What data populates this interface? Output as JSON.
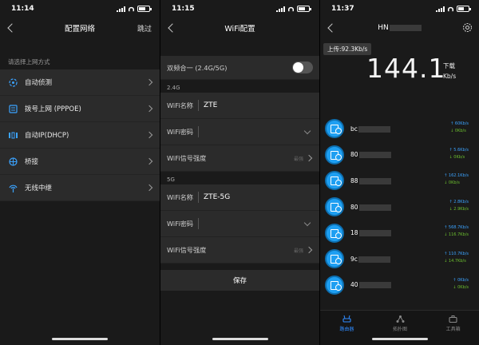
{
  "panel1": {
    "time": "11:14",
    "title": "配置网络",
    "skip": "跳过",
    "section_label": "请选择上网方式",
    "items": [
      {
        "label": "自动侦测",
        "icon": "auto-detect-icon"
      },
      {
        "label": "拨号上网 (PPPOE)",
        "icon": "dialup-icon"
      },
      {
        "label": "自动IP(DHCP)",
        "icon": "dhcp-icon"
      },
      {
        "label": "桥接",
        "icon": "bridge-icon"
      },
      {
        "label": "无线中继",
        "icon": "wireless-relay-icon"
      }
    ]
  },
  "panel2": {
    "time": "11:15",
    "title": "WiFi配置",
    "dual_band_label": "双频合一 (2.4G/5G)",
    "dual_band_on": false,
    "band24": {
      "band_label": "2.4G",
      "name_label": "WiFi名称",
      "name_value": "ZTE",
      "password_label": "WiFi密码",
      "strength_label": "WiFi信号强度",
      "strength_value": "最强"
    },
    "band5": {
      "band_label": "5G",
      "name_label": "WiFi名称",
      "name_value": "ZTE-5G",
      "password_label": "WiFi密码",
      "strength_label": "WiFi信号强度",
      "strength_value": "最强"
    },
    "save_label": "保存"
  },
  "panel3": {
    "time": "11:37",
    "title": "HN",
    "upload": "上传:92.3Kb/s",
    "download_value": "144.1",
    "download_label": "下载",
    "download_unit": "Kb/s",
    "devices": [
      {
        "name": "bc",
        "up": "↑ 60Kb/s",
        "down": "↓ 0Kb/s"
      },
      {
        "name": "80",
        "up": "↑ 5.6Kb/s",
        "down": "↓ 0Kb/s"
      },
      {
        "name": "88",
        "up": "↑ 162.1Kb/s",
        "down": "↓ 0Kb/s"
      },
      {
        "name": "80",
        "up": "↑ 2.8Kb/s",
        "down": "↓ 2.9Kb/s"
      },
      {
        "name": "18",
        "up": "↑ 568.7Kb/s",
        "down": "↓ 116.7Kb/s"
      },
      {
        "name": "9c",
        "up": "↑ 110.7Kb/s",
        "down": "↓ 14.7Kb/s"
      },
      {
        "name": "40",
        "up": "↑ 0Kb/s",
        "down": "↓ 0Kb/s"
      }
    ],
    "tabs": [
      {
        "label": "路由器",
        "icon": "router-icon",
        "active": true
      },
      {
        "label": "拓扑图",
        "icon": "topology-icon",
        "active": false
      },
      {
        "label": "工具箱",
        "icon": "toolbox-icon",
        "active": false
      }
    ]
  },
  "colors": {
    "accent": "#2f8bff",
    "device_blue": "#1e9ff2",
    "bg": "#1a1a1a",
    "card": "#2b2b2b"
  }
}
